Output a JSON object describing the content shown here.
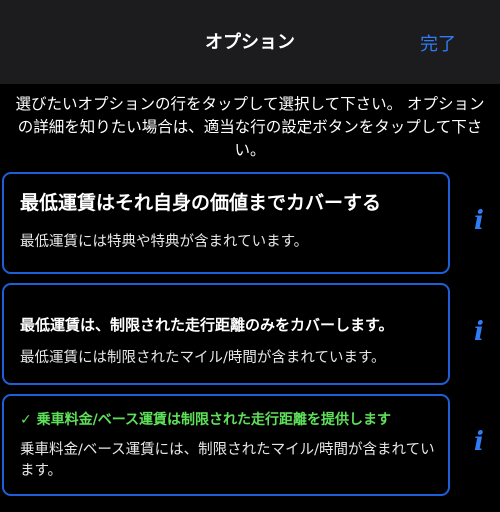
{
  "nav": {
    "title": "オプション",
    "done_label": "完了"
  },
  "instructions": "選びたいオプションの行をタップして選択して下さい。 オプションの詳細を知りたい場合は、適当な行の設定ボタンをタップして下さい。",
  "options": [
    {
      "title": "最低運賃はそれ自身の価値までカバーする",
      "description": "最低運賃には特典や特典が含まれています。",
      "selected": false
    },
    {
      "title": "最低運賃は、制限された走行距離のみをカバーします。",
      "description": "最低運賃には制限されたマイル/時間が含まれています。",
      "selected": false
    },
    {
      "check_mark": "✓",
      "title": "乗車料金/ベース運賃は制限された走行距離を提供します",
      "description": "乗車料金/ベース運賃には、制限されたマイル/時間が含まれています。",
      "selected": true
    }
  ],
  "info_glyph": "i",
  "colors": {
    "accent": "#2f7cf6",
    "card_border": "#1e5fd8",
    "selected_text": "#5fe05a",
    "nav_background": "#1c1c1e",
    "background": "#000000"
  }
}
